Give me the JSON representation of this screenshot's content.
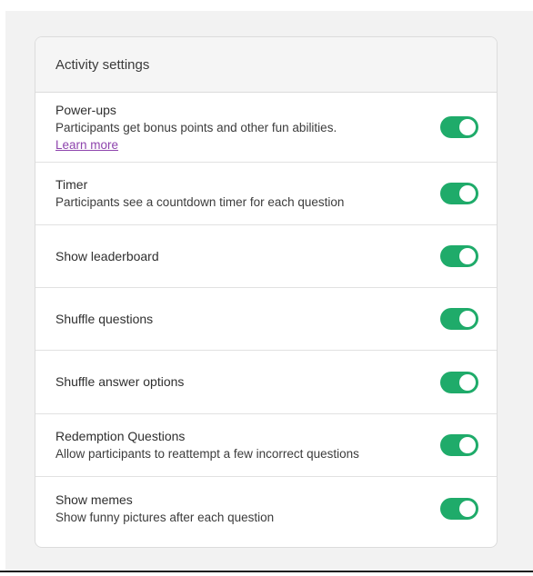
{
  "settings": {
    "title": "Activity settings",
    "colors": {
      "toggle_on": "#1fab6a",
      "link": "#8e44ad"
    },
    "items": [
      {
        "title": "Power-ups",
        "description": "Participants get bonus points and other fun abilities.",
        "link": "Learn more",
        "enabled": true
      },
      {
        "title": "Timer",
        "description": "Participants see a countdown timer for each question",
        "enabled": true
      },
      {
        "title": "Show leaderboard",
        "enabled": true
      },
      {
        "title": "Shuffle questions",
        "enabled": true
      },
      {
        "title": "Shuffle answer options",
        "enabled": true
      },
      {
        "title": "Redemption Questions",
        "description": "Allow participants to reattempt a few incorrect questions",
        "enabled": true
      },
      {
        "title": "Show memes",
        "description": "Show funny pictures after each question",
        "enabled": true
      }
    ]
  }
}
